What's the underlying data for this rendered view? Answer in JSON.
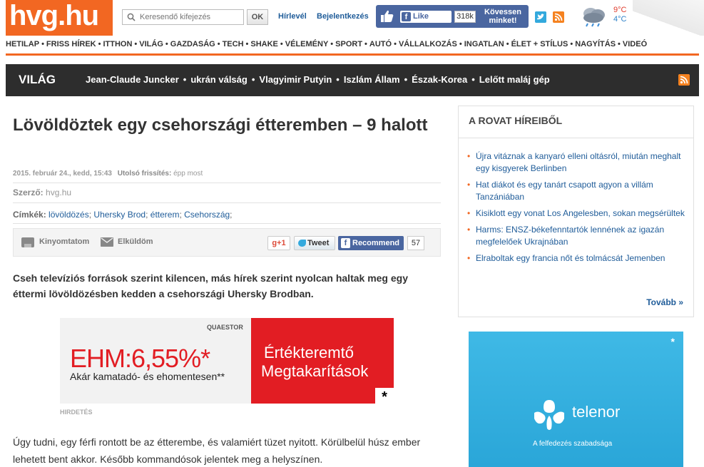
{
  "header": {
    "logo": "hvg.hu",
    "search_placeholder": "Keresendő kifejezés",
    "search_button": "OK",
    "newsletter_link": "Hírlevél",
    "login_link": "Bejelentkezés",
    "fb_like_label": "Like",
    "fb_like_count": "318k",
    "fb_follow_line1": "Kövessen",
    "fb_follow_line2": "minket!",
    "temp_high": "9°C",
    "temp_low": "4°C"
  },
  "topnav": [
    "HETILAP",
    "FRISS HÍREK",
    "ITTHON",
    "VILÁG",
    "GAZDASÁG",
    "TECH",
    "SHAKE",
    "VÉLEMÉNY",
    "SPORT",
    "AUTÓ",
    "VÁLLALKOZÁS",
    "INGATLAN",
    "ÉLET + STÍLUS",
    "NAGYÍTÁS",
    "VIDEÓ"
  ],
  "section": {
    "title": "VILÁG",
    "links": [
      "Jean-Claude Juncker",
      "ukrán válság",
      "Vlagyimir Putyin",
      "Iszlám Állam",
      "Észak-Korea",
      "Lelőtt maláj gép"
    ]
  },
  "article": {
    "title": "Lövöldöztek egy csehországi étteremben – 9 halott",
    "datetime": "2015. február 24., kedd, 15:43",
    "updated_label": "Utolsó frissítés:",
    "updated_value": "épp most",
    "author_label": "Szerző:",
    "author": "hvg.hu",
    "tags_label": "Címkék:",
    "tags": [
      "lövöldözés",
      "Uhersky Brod",
      "étterem",
      "Csehország"
    ],
    "print_label": "Kinyomtatom",
    "send_label": "Elküldöm",
    "gplus_label": "+1",
    "tweet_label": "Tweet",
    "recommend_label": "Recommend",
    "recommend_count": "57",
    "lead": "Cseh televíziós források szerint kilencen, más hírek szerint nyolcan haltak meg egy éttermi lövöldözésben kedden a csehországi Uhersky Brodban.",
    "body": "Úgy tudni, egy férfi rontott be az étterembe, és valamiért tüzet nyitott. Körülbelül húsz ember lehetett bent akkor. Később kommandósok jelentek meg a helyszínen."
  },
  "ad": {
    "brand": "QUAESTOR",
    "rate": "EHM:6,55%*",
    "subtext": "Akár kamatadó- és ehomentesen**",
    "right_line1": "Értékteremtő",
    "right_line2": "Megtakarítások",
    "star": "*",
    "label": "HIRDETÉS"
  },
  "sidebar": {
    "title": "A ROVAT HÍREIBŐL",
    "items": [
      "Újra vitáznak a kanyaró elleni oltásról, miután meghalt egy kisgyerek Berlinben",
      "Hat diákot és egy tanárt csapott agyon a villám Tanzániában",
      "Kisiklott egy vonat Los Angelesben, sokan megsérültek",
      "Harms: ENSZ-békefenntartók lennének az igazán megfelelőek Ukrajnában",
      "Elraboltak egy francia nőt és tolmácsát Jemenben"
    ],
    "more": "Tovább »"
  },
  "telenor_ad": {
    "star": "*",
    "brand": "telenor",
    "slogan": "A felfedezés szabadsága"
  }
}
